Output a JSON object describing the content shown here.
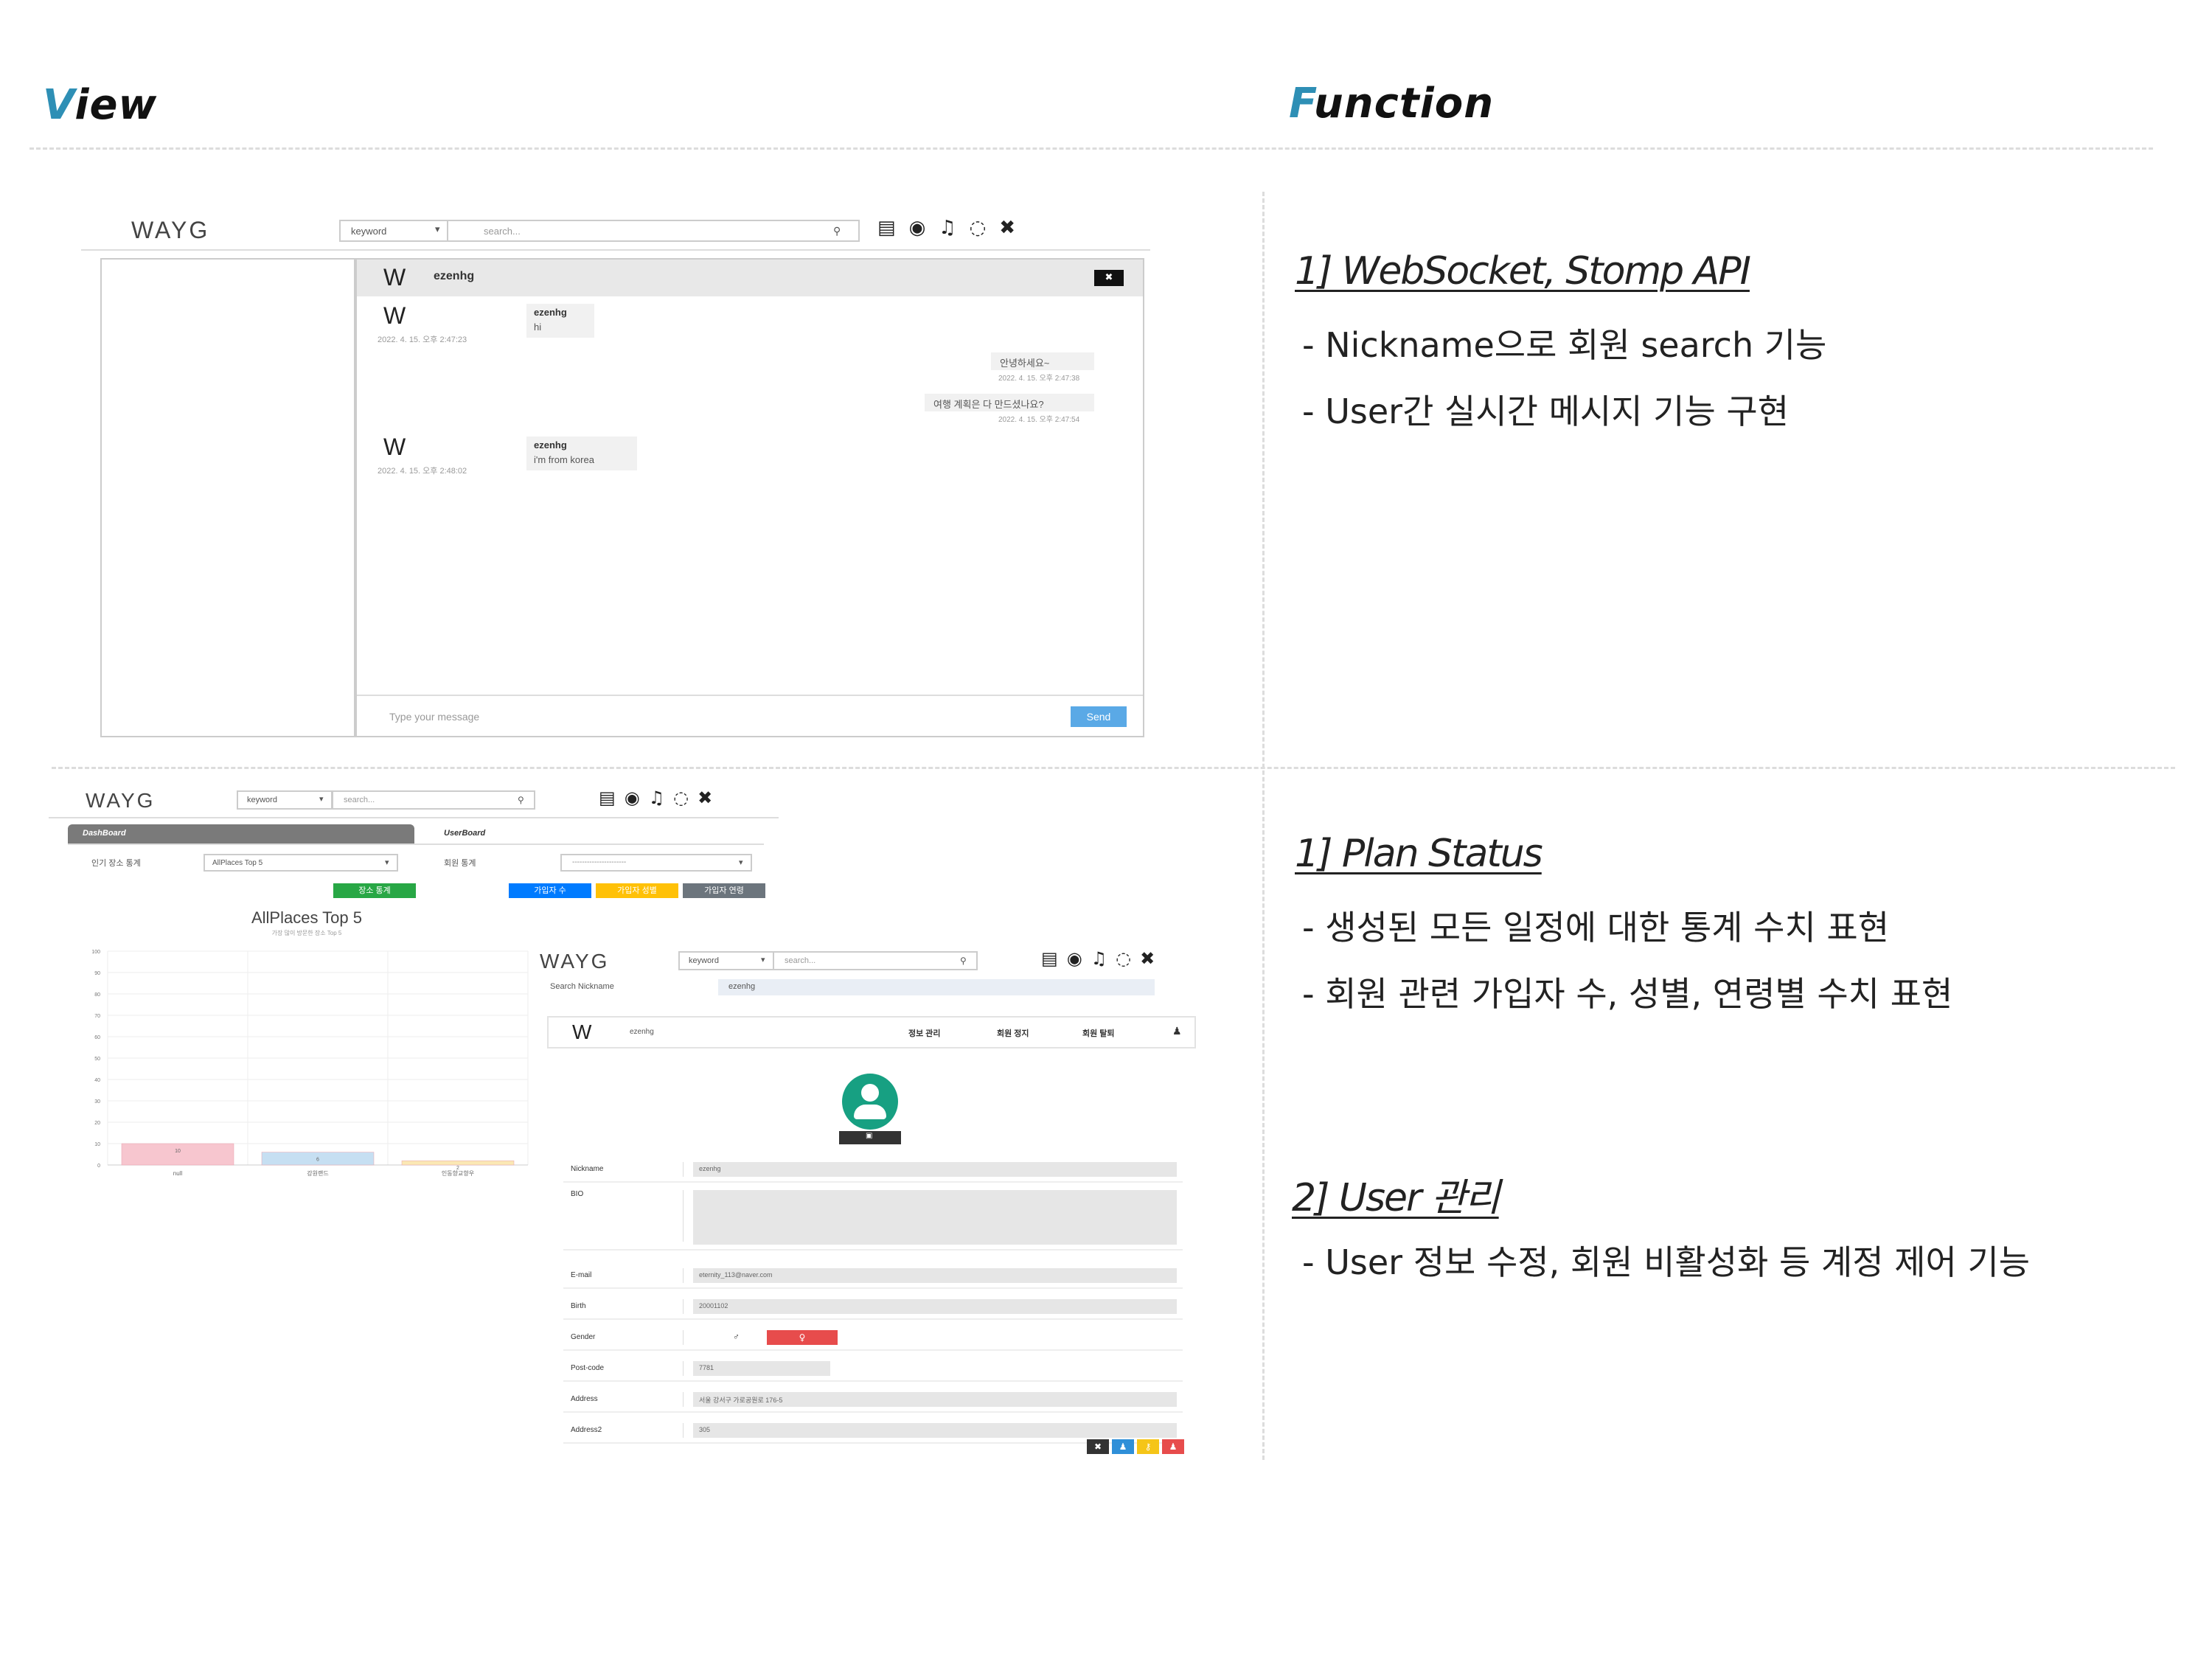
{
  "headers": {
    "view": "View",
    "view_first": "V",
    "view_rest": "iew",
    "function": "Function",
    "function_first": "F",
    "function_rest": "unction"
  },
  "chat_shot": {
    "logo": "WAYG",
    "search_select": "keyword",
    "search_placeholder": "search...",
    "chat_user": "ezenhg",
    "close_label": "✖",
    "messages": [
      {
        "side": "left",
        "name": "ezenhg",
        "text": "hi",
        "time": "2022. 4. 15. 오후 2:47:23"
      },
      {
        "side": "right",
        "text": "안녕하세요~",
        "time": "2022. 4. 15. 오후 2:47:38"
      },
      {
        "side": "right",
        "text": "여행 계획은 다 만드셨나요?",
        "time": "2022. 4. 15. 오후 2:47:54"
      },
      {
        "side": "left",
        "name": "ezenhg",
        "text": "i'm from korea",
        "time": "2022. 4. 15. 오후 2:48:02"
      }
    ],
    "input_placeholder": "Type your message",
    "send_label": "Send"
  },
  "dash_shot": {
    "logo": "WAYG",
    "search_select": "keyword",
    "search_placeholder": "search...",
    "tab_dashboard": "DashBoard",
    "tab_userboard": "UserBoard",
    "label_places": "인기 장소 통계",
    "select_places": "AllPlaces Top 5",
    "button_places": "장소 통계",
    "label_users": "회원 통계",
    "select_users": "----------------------",
    "btn_count": "가입자 수",
    "btn_gender": "가입자 성별",
    "btn_age": "가입자 연령",
    "colors": {
      "green": "#28a745",
      "blue": "#007bff",
      "yellow": "#ffc107",
      "gray": "#6c757d"
    }
  },
  "chart_data": {
    "type": "bar",
    "title": "AllPlaces Top 5",
    "subtitle": "가장 많이 방문한 장소 Top 5",
    "categories": [
      "null",
      "강원랜드",
      "인동향교향우"
    ],
    "values": [
      10,
      6,
      2
    ],
    "value_labels": [
      "10",
      "6",
      "2"
    ],
    "colors": [
      "#f7c6cf",
      "#c6dff2",
      "#fbe8b4"
    ],
    "ylim": [
      0,
      100
    ],
    "y_ticks": [
      "100",
      "90",
      "80",
      "70",
      "60",
      "50",
      "40",
      "30",
      "20",
      "10",
      "0"
    ],
    "grid": true
  },
  "user_shot": {
    "logo": "WAYG",
    "search_select": "keyword",
    "search_placeholder": "search...",
    "search_nick_label": "Search Nickname",
    "search_nick_value": "ezenhg",
    "profile_name": "ezenhg",
    "tabs": [
      "정보 관리",
      "회원 정지",
      "회원 탈퇴"
    ],
    "fields": [
      {
        "label": "Nickname",
        "value": "ezenhg"
      },
      {
        "label": "BIO",
        "value": ""
      },
      {
        "label": "E-mail",
        "value": "eternity_113@naver.com"
      },
      {
        "label": "Birth",
        "value": "20001102"
      },
      {
        "label": "Gender",
        "value": "♂"
      },
      {
        "label": "Post-code",
        "value": "7781"
      },
      {
        "label": "Address",
        "value": "서울 강서구 가로공원로 176-5"
      },
      {
        "label": "Address2",
        "value": "305"
      }
    ],
    "gender_female": "♀",
    "colors": {
      "teal": "#17a082",
      "dark": "#333",
      "blue": "#2f8fd8",
      "yellow": "#f5c518",
      "red": "#e74c4c"
    }
  },
  "functions": {
    "f1_title": "1] WebSocket, Stomp API",
    "f1_lines": [
      "- Nickname으로 회원 search 기능",
      "- User간 실시간 메시지 기능 구현"
    ],
    "f2_title": "1] Plan Status",
    "f2_lines": [
      "- 생성된 모든 일정에 대한 통계 수치 표현",
      "- 회원 관련 가입자 수, 성별, 연령별 수치 표현"
    ],
    "f3_title": "2] User 관리",
    "f3_lines": [
      "- User 정보 수정, 회원 비활성화 등 계정 제어 기능"
    ]
  }
}
